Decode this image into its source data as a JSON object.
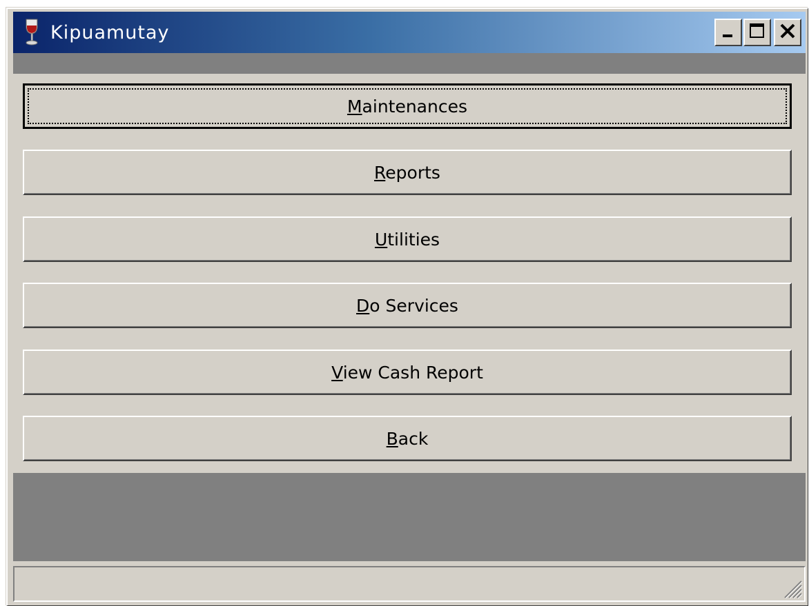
{
  "window": {
    "title": "Kipuamutay",
    "controls": {
      "minimize": "minimize-icon",
      "maximize": "maximize-icon",
      "close": "close-icon"
    }
  },
  "menu_buttons": [
    {
      "label_prefix": "",
      "mnemonic": "M",
      "label_rest": "aintenances",
      "focused": true
    },
    {
      "label_prefix": "",
      "mnemonic": "R",
      "label_rest": "eports",
      "focused": false
    },
    {
      "label_prefix": "",
      "mnemonic": "U",
      "label_rest": "tilities",
      "focused": false
    },
    {
      "label_prefix": "",
      "mnemonic": "D",
      "label_rest": "o Services",
      "focused": false
    },
    {
      "label_prefix": "",
      "mnemonic": "V",
      "label_rest": "iew Cash Report",
      "focused": false
    },
    {
      "label_prefix": "",
      "mnemonic": "B",
      "label_rest": "ack",
      "focused": false
    }
  ],
  "colors": {
    "titlebar_start": "#0a246a",
    "titlebar_end": "#a6caf0",
    "face": "#d4d0c8",
    "panel_dark": "#808080"
  },
  "icons": {
    "app": "wine-glass-icon",
    "resize": "resize-grip-icon"
  }
}
